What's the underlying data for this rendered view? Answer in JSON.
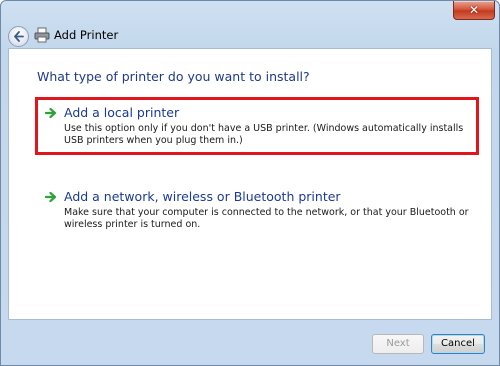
{
  "window": {
    "title": "Add Printer",
    "close_glyph": "✕",
    "back_icon": "back-arrow-icon",
    "title_icon": "printer-icon"
  },
  "main": {
    "question": "What type of printer do you want to install?",
    "options": [
      {
        "title": "Add a local printer",
        "description": "Use this option only if you don't have a USB printer. (Windows automatically installs USB printers when you plug them in.)",
        "icon": "green-arrow-icon",
        "highlighted": true
      },
      {
        "title": "Add a network, wireless or Bluetooth printer",
        "description": "Make sure that your computer is connected to the network, or that your Bluetooth or wireless printer is turned on.",
        "icon": "green-arrow-icon",
        "highlighted": false
      }
    ]
  },
  "footer": {
    "next_label": "Next",
    "cancel_label": "Cancel",
    "next_enabled": false
  },
  "colors": {
    "highlight": "#e0161c",
    "heading": "#1e3a87",
    "arrow": "#2fa33a"
  }
}
